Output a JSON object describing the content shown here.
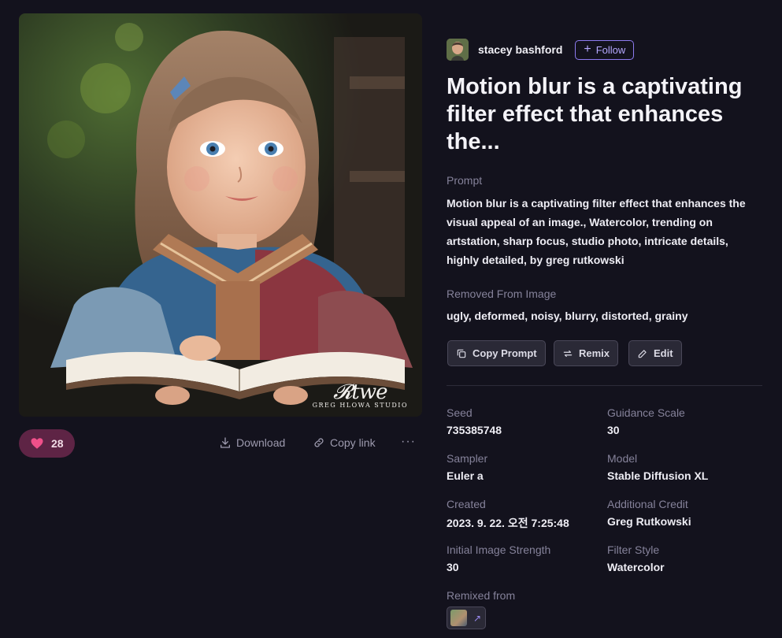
{
  "artwork": {
    "signature_script": "Rtwe",
    "signature_studio": "GREG HLOWA STUDIO"
  },
  "actions": {
    "like_count": "28",
    "download_label": "Download",
    "copy_link_label": "Copy link",
    "more_label": "···"
  },
  "author": {
    "name": "stacey bashford",
    "follow_label": "Follow"
  },
  "title": "Motion blur is a captivating filter effect that enhances the...",
  "prompt": {
    "label": "Prompt",
    "text": "Motion blur is a captivating filter effect that enhances the visual appeal of an image., Watercolor, trending on artstation, sharp focus, studio photo, intricate details, highly detailed, by greg rutkowski"
  },
  "negative": {
    "label": "Removed From Image",
    "text": "ugly, deformed, noisy, blurry, distorted, grainy"
  },
  "buttons": {
    "copy_prompt": "Copy Prompt",
    "remix": "Remix",
    "edit": "Edit"
  },
  "details": {
    "seed": {
      "label": "Seed",
      "value": "735385748"
    },
    "guidance": {
      "label": "Guidance Scale",
      "value": "30"
    },
    "sampler": {
      "label": "Sampler",
      "value": "Euler a"
    },
    "model": {
      "label": "Model",
      "value": "Stable Diffusion XL"
    },
    "created": {
      "label": "Created",
      "value": "2023. 9. 22. 오전 7:25:48"
    },
    "credit": {
      "label": "Additional Credit",
      "value": "Greg Rutkowski"
    },
    "strength": {
      "label": "Initial Image Strength",
      "value": "30"
    },
    "filter": {
      "label": "Filter Style",
      "value": "Watercolor"
    },
    "remixed": {
      "label": "Remixed from"
    }
  },
  "colors": {
    "background": "#13121d",
    "accent": "#8d7bf0",
    "like_pill": "#5e2445",
    "heart": "#f0508a"
  }
}
